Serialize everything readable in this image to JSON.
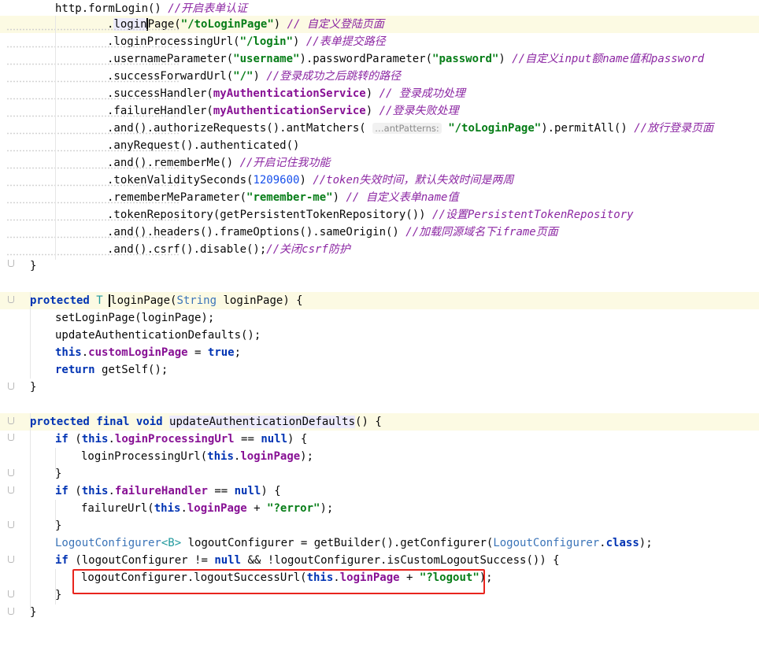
{
  "editor": {
    "lines": [
      {
        "indent": "    ",
        "parts": [
          [
            "http.formLogin() ",
            ""
          ],
          [
            "//开启表单认证",
            "cm-ital"
          ]
        ]
      },
      {
        "indent": "            ",
        "hl": true,
        "parts": [
          [
            ".",
            ""
          ],
          [
            "login",
            "identhl"
          ],
          [
            "|",
            "cursor"
          ],
          [
            "Page(",
            ""
          ],
          [
            "\"/toLoginPage\"",
            "str"
          ],
          [
            ") ",
            ""
          ],
          [
            "// 自定义登陆页面",
            "cm-ital"
          ]
        ]
      },
      {
        "indent": "            ",
        "parts": [
          [
            ".loginProcessingUrl(",
            ""
          ],
          [
            "\"/login\"",
            "str"
          ],
          [
            ") ",
            ""
          ],
          [
            "//表单提交路径",
            "cm-ital"
          ]
        ]
      },
      {
        "indent": "            ",
        "parts": [
          [
            ".usernameParameter(",
            ""
          ],
          [
            "\"username\"",
            "str"
          ],
          [
            ").passwordParameter(",
            ""
          ],
          [
            "\"password\"",
            "str"
          ],
          [
            ") ",
            ""
          ],
          [
            "//自定义input额name值和password",
            "cm-ital"
          ]
        ]
      },
      {
        "indent": "            ",
        "parts": [
          [
            ".successForwardUrl(",
            ""
          ],
          [
            "\"/\"",
            "str"
          ],
          [
            ") ",
            ""
          ],
          [
            "//登录成功之后跳转的路径",
            "cm-ital"
          ]
        ]
      },
      {
        "indent": "            ",
        "parts": [
          [
            ".successHandler(",
            ""
          ],
          [
            "myAuthenticationService",
            "fld"
          ],
          [
            ") ",
            ""
          ],
          [
            "// 登录成功处理",
            "cm-ital"
          ]
        ]
      },
      {
        "indent": "            ",
        "parts": [
          [
            ".failureHandler(",
            ""
          ],
          [
            "myAuthenticationService",
            "fld"
          ],
          [
            ") ",
            ""
          ],
          [
            "//登录失败处理",
            "cm-ital"
          ]
        ]
      },
      {
        "indent": "            ",
        "parts": [
          [
            ".and().authorizeRequests().antMatchers( ",
            ""
          ],
          [
            "…antPatterns:",
            "hint"
          ],
          [
            " ",
            ""
          ],
          [
            "\"/toLoginPage\"",
            "str"
          ],
          [
            ").permitAll() ",
            ""
          ],
          [
            "//放行登录页面",
            "cm-ital"
          ]
        ]
      },
      {
        "indent": "            ",
        "parts": [
          [
            ".anyRequest().authenticated()",
            ""
          ]
        ]
      },
      {
        "indent": "            ",
        "parts": [
          [
            ".and().rememberMe() ",
            ""
          ],
          [
            "//开启记住我功能",
            "cm-ital"
          ]
        ]
      },
      {
        "indent": "            ",
        "parts": [
          [
            ".tokenValiditySeconds(",
            ""
          ],
          [
            "1209600",
            "num"
          ],
          [
            ") ",
            ""
          ],
          [
            "//token失效时间，默认失效时间是两周",
            "cm-ital"
          ]
        ]
      },
      {
        "indent": "            ",
        "parts": [
          [
            ".rememberMeParameter(",
            ""
          ],
          [
            "\"remember-me\"",
            "str"
          ],
          [
            ") ",
            ""
          ],
          [
            "// 自定义表单name值",
            "cm-ital"
          ]
        ]
      },
      {
        "indent": "            ",
        "parts": [
          [
            ".tokenRepository(getPersistentTokenRepository()) ",
            ""
          ],
          [
            "//设置PersistentTokenRepository",
            "cm-ital"
          ]
        ]
      },
      {
        "indent": "            ",
        "parts": [
          [
            ".and().headers().frameOptions().sameOrigin() ",
            ""
          ],
          [
            "//加载同源域名下iframe页面",
            "cm-ital"
          ]
        ]
      },
      {
        "indent": "            ",
        "parts": [
          [
            ".and().csrf().disable();",
            ""
          ],
          [
            "//关闭csrf防护",
            "cm-ital"
          ]
        ]
      },
      {
        "indent": "",
        "parts": [
          [
            "}",
            ""
          ]
        ]
      },
      {
        "indent": "",
        "parts": []
      },
      {
        "indent": "",
        "hl": true,
        "parts": [
          [
            "protected ",
            "kw"
          ],
          [
            "T ",
            "gen"
          ],
          [
            "|",
            "cursor"
          ],
          [
            "loginPage(",
            ""
          ],
          [
            "String ",
            "typ"
          ],
          [
            "loginPage) {",
            ""
          ]
        ]
      },
      {
        "indent": "    ",
        "parts": [
          [
            "setLoginPage(loginPage);",
            ""
          ]
        ]
      },
      {
        "indent": "    ",
        "parts": [
          [
            "updateAuthenticationDefaults();",
            ""
          ]
        ]
      },
      {
        "indent": "    ",
        "parts": [
          [
            "this",
            "kw"
          ],
          [
            ".",
            ""
          ],
          [
            "customLoginPage",
            "fld"
          ],
          [
            " = ",
            ""
          ],
          [
            "true",
            "kw"
          ],
          [
            ";",
            ""
          ]
        ]
      },
      {
        "indent": "    ",
        "parts": [
          [
            "return ",
            "kw"
          ],
          [
            "getSelf();",
            ""
          ]
        ]
      },
      {
        "indent": "",
        "parts": [
          [
            "}",
            ""
          ]
        ]
      },
      {
        "indent": "",
        "parts": []
      },
      {
        "indent": "",
        "hl": true,
        "parts": [
          [
            "protected final void ",
            "kw"
          ],
          [
            "updateAuthenticationDefaults",
            "identhl"
          ],
          [
            "() {",
            ""
          ]
        ]
      },
      {
        "indent": "    ",
        "parts": [
          [
            "if ",
            "kw"
          ],
          [
            "(",
            ""
          ],
          [
            "this",
            "kw"
          ],
          [
            ".",
            ""
          ],
          [
            "loginProcessingUrl",
            "fld"
          ],
          [
            " == ",
            ""
          ],
          [
            "null",
            "kw"
          ],
          [
            ") {",
            ""
          ]
        ]
      },
      {
        "indent": "        ",
        "parts": [
          [
            "loginProcessingUrl(",
            ""
          ],
          [
            "this",
            "kw"
          ],
          [
            ".",
            ""
          ],
          [
            "loginPage",
            "fld"
          ],
          [
            ");",
            ""
          ]
        ]
      },
      {
        "indent": "    ",
        "parts": [
          [
            "}",
            ""
          ]
        ]
      },
      {
        "indent": "    ",
        "parts": [
          [
            "if ",
            "kw"
          ],
          [
            "(",
            ""
          ],
          [
            "this",
            "kw"
          ],
          [
            ".",
            ""
          ],
          [
            "failureHandler",
            "fld"
          ],
          [
            " == ",
            ""
          ],
          [
            "null",
            "kw"
          ],
          [
            ") {",
            ""
          ]
        ]
      },
      {
        "indent": "        ",
        "parts": [
          [
            "failureUrl(",
            ""
          ],
          [
            "this",
            "kw"
          ],
          [
            ".",
            ""
          ],
          [
            "loginPage",
            "fld"
          ],
          [
            " + ",
            ""
          ],
          [
            "\"?error\"",
            "str"
          ],
          [
            ");",
            ""
          ]
        ]
      },
      {
        "indent": "    ",
        "parts": [
          [
            "}",
            ""
          ]
        ]
      },
      {
        "indent": "    ",
        "parts": [
          [
            "LogoutConfigurer",
            "typ"
          ],
          [
            "<B>",
            "gen"
          ],
          [
            " logoutConfigurer = getBuilder().getConfigurer(",
            ""
          ],
          [
            "LogoutConfigurer",
            "typ"
          ],
          [
            ".",
            ""
          ],
          [
            "class",
            "kw"
          ],
          [
            ");",
            ""
          ]
        ]
      },
      {
        "indent": "    ",
        "parts": [
          [
            "if ",
            "kw"
          ],
          [
            "(logoutConfigurer != ",
            ""
          ],
          [
            "null",
            "kw"
          ],
          [
            " && !logoutConfigurer.isCustomLogoutSuccess()) {",
            ""
          ]
        ]
      },
      {
        "indent": "        ",
        "parts": [
          [
            "logoutConfigurer.logoutSuccessUrl(",
            ""
          ],
          [
            "this",
            "kw"
          ],
          [
            ".",
            ""
          ],
          [
            "loginPage",
            "fld"
          ],
          [
            " + ",
            ""
          ],
          [
            "\"?logout\"",
            "str"
          ],
          [
            ");",
            ""
          ]
        ]
      },
      {
        "indent": "    ",
        "parts": [
          [
            "}",
            ""
          ]
        ]
      },
      {
        "indent": "",
        "parts": [
          [
            "}",
            ""
          ]
        ]
      }
    ]
  }
}
